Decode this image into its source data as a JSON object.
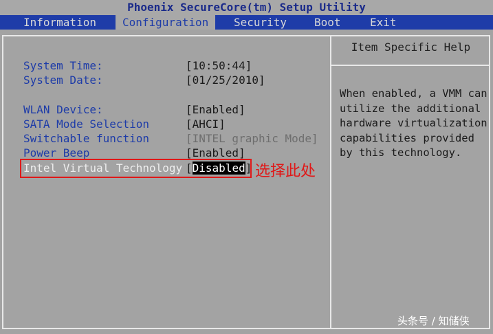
{
  "title": "Phoenix SecureCore(tm) Setup Utility",
  "menu": {
    "tabs": [
      {
        "label": "Information"
      },
      {
        "label": "Configuration"
      },
      {
        "label": "Security"
      },
      {
        "label": "Boot"
      },
      {
        "label": "Exit"
      }
    ]
  },
  "settings": [
    {
      "label": "System Time:",
      "value": "[10:50:44]"
    },
    {
      "label": "System Date:",
      "value": "[01/25/2010]"
    },
    {
      "label": "WLAN Device:",
      "value": "[Enabled]"
    },
    {
      "label": "SATA Mode Selection",
      "value": "[AHCI]"
    },
    {
      "label": "Switchable function",
      "value": "[INTEL graphic Mode]"
    },
    {
      "label": "Power Beep",
      "value": "[Enabled]"
    },
    {
      "label": "Intel Virtual Technology",
      "value_open": "[",
      "value": "Disabled",
      "value_close": "]"
    }
  ],
  "help": {
    "title": "Item Specific Help",
    "lines": [
      "When enabled, a VMM can",
      "utilize the additional",
      "hardware virtualization",
      "capabilities provided",
      "by this technology."
    ]
  },
  "annotation": "选择此处",
  "watermark": "头条号 / 知储侠",
  "colors": {
    "menu_bar": "#1e3ca8",
    "background": "#a3a3a3",
    "annotation": "#e01818",
    "item_text": "#1e3ca8"
  }
}
